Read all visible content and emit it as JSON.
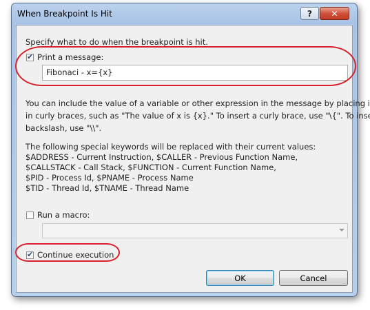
{
  "window": {
    "title": "When Breakpoint Is Hit",
    "help_glyph": "?",
    "close_glyph": "✕"
  },
  "dialog": {
    "instruction": "Specify what to do when the breakpoint is hit.",
    "print_message": {
      "label": "Print a message:",
      "checked": true,
      "value": "Fibonaci - x={x}"
    },
    "help_text": {
      "line1": "You can include the value of a variable or other expression in the message by placing it",
      "line2": "in curly braces, such as \"The value of x is {x}.\" To insert a curly brace, use \"\\{\". To insert a",
      "line3": "backslash, use \"\\\\\"."
    },
    "keywords": {
      "intro": "The following special keywords will be replaced with their current values:",
      "line1": "$ADDRESS - Current Instruction, $CALLER - Previous Function Name,",
      "line2": "$CALLSTACK - Call Stack, $FUNCTION - Current Function Name,",
      "line3": "$PID - Process Id, $PNAME - Process Name",
      "line4": "$TID - Thread Id, $TNAME - Thread Name"
    },
    "run_macro": {
      "label": "Run a macro:",
      "checked": false,
      "value": ""
    },
    "continue_execution": {
      "label": "Continue execution",
      "checked": true
    },
    "buttons": {
      "ok": "OK",
      "cancel": "Cancel"
    }
  },
  "colors": {
    "annotation_red": "#d9212b",
    "titlebar_blue": "#a9c4e6"
  }
}
